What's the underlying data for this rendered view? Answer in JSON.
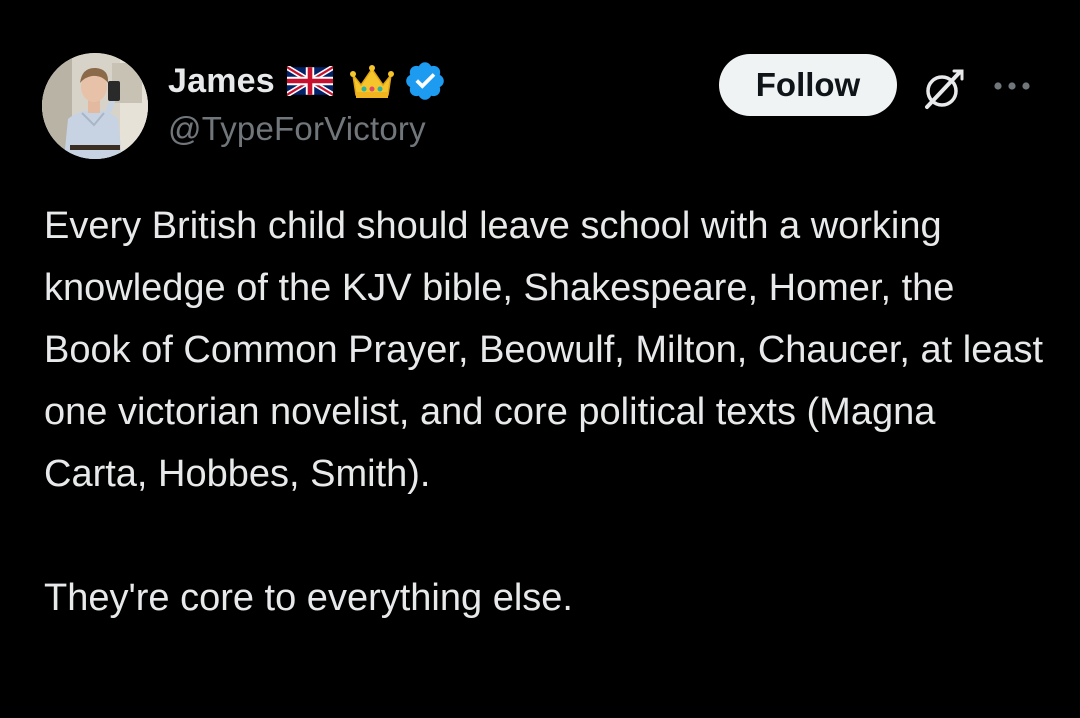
{
  "author": {
    "display_name": "James",
    "handle": "@TypeForVictory",
    "avatar_icon": "profile-photo",
    "badges": [
      "uk-flag-icon",
      "crown-icon",
      "verified-badge-icon"
    ],
    "verified_color": "#1d9bf0"
  },
  "actions": {
    "follow_label": "Follow",
    "grok_icon": "grok-icon",
    "more_icon": "more-options-icon"
  },
  "tweet": {
    "paragraph_1": "Every British child should leave school with a working knowledge of the KJV bible, Shakespeare, Homer, the Book of Common Prayer, Beowulf, Milton, Chaucer, at least one victorian novelist, and core political texts (Magna Carta, Hobbes, Smith).",
    "paragraph_2": "They're core to everything else."
  },
  "theme": {
    "background": "#000000",
    "text": "#e7e9ea",
    "secondary_text": "#71767b",
    "follow_button_bg": "#eff3f4"
  }
}
